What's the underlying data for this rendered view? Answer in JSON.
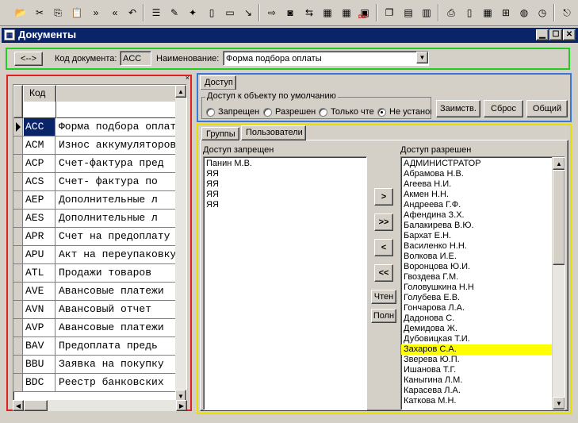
{
  "window": {
    "title": "Документы"
  },
  "toolbar": {
    "icons": [
      "open-folder-icon",
      "cut-icon",
      "copy-icon",
      "paste-icon",
      "fast-forward-icon",
      "rewind-icon",
      "undo-icon",
      "list-icon",
      "pin-icon",
      "wizard-icon",
      "new-doc-icon",
      "doc-icon",
      "arrow-icon",
      "export-icon",
      "db-icon",
      "transfer-icon",
      "excel-icon",
      "excel2-icon",
      "dbf-icon",
      "windows-icon",
      "split-h-icon",
      "split-v-icon",
      "print-icon",
      "page-icon",
      "calendar-icon",
      "calculator-icon",
      "globe-icon",
      "clock-icon",
      "exit-icon"
    ],
    "dbf_label": "DBF"
  },
  "form": {
    "swap_button": "<-->",
    "code_label": "Код документа:",
    "code_value": "ACC",
    "name_label": "Наименование:",
    "name_value": "Форма подбора оплаты"
  },
  "grid": {
    "header": "Код",
    "rows": [
      {
        "code": "ACC",
        "name": "Форма подбора оплаты"
      },
      {
        "code": "ACM",
        "name": "Износ аккумуляторов"
      },
      {
        "code": "ACP",
        "name": "Счет-фактура пред"
      },
      {
        "code": "ACS",
        "name": "Счет- фактура по"
      },
      {
        "code": "AEP",
        "name": "Дополнительные л"
      },
      {
        "code": "AES",
        "name": "Дополнительные л"
      },
      {
        "code": "APR",
        "name": "Счет на предоплату"
      },
      {
        "code": "APU",
        "name": "Акт на переупаковку"
      },
      {
        "code": "ATL",
        "name": "Продажи товаров"
      },
      {
        "code": "AVE",
        "name": "Авансовые платежи"
      },
      {
        "code": "AVN",
        "name": "Авансовый отчет"
      },
      {
        "code": "AVP",
        "name": "Авансовые платежи"
      },
      {
        "code": "BAV",
        "name": "Предоплата предь"
      },
      {
        "code": "BBU",
        "name": "Заявка на покупку"
      },
      {
        "code": "BDC",
        "name": "Реестр банковских"
      }
    ]
  },
  "access": {
    "tab": "Доступ",
    "default_group_label": "Доступ к объекту по умолчанию",
    "radios": [
      "Запрещен",
      "Разрешен",
      "Только чтение",
      "Не установлен"
    ],
    "selected_radio": 3,
    "buttons": {
      "borrow": "Заимств.",
      "reset": "Сброс",
      "common": "Общий"
    }
  },
  "users": {
    "tabs": [
      "Группы",
      "Пользователи"
    ],
    "active_tab": 1,
    "denied_label": "Доступ запрещен",
    "allowed_label": "Доступ разрешен",
    "denied": [
      "Панин М.В.",
      "ЯЯ",
      "ЯЯ",
      "ЯЯ",
      "ЯЯ"
    ],
    "allowed": [
      "АДМИНИСТРАТОР",
      "Абрамова Н.В.",
      "Агеева Н.И.",
      "Акмен Н.Н.",
      "Андреева Г.Ф.",
      "Афендина З.Х.",
      "Балакирева В.Ю.",
      "Бархат Е.Н.",
      "Василенко Н.Н.",
      "Волкова И.Е.",
      "Воронцова Ю.И.",
      "Гвоздева Г.М.",
      "Головушкина Н.Н",
      "Голубева Е.В.",
      "Гончарова Л.А.",
      "Дадонова С.",
      "Демидова Ж.",
      "Дубовицкая Т.И.",
      "Захаров С.А.",
      "Зверева Ю.П.",
      "Ишанова Т.Г.",
      "Каныгина Л.М.",
      "Карасева Л.А.",
      "Каткова М.Н."
    ],
    "highlighted": "Захаров С.А.",
    "move_buttons": {
      "one_right": ">",
      "all_right": ">>",
      "one_left": "<",
      "all_left": "<<",
      "read": "Чтен",
      "full": "Полн"
    }
  }
}
